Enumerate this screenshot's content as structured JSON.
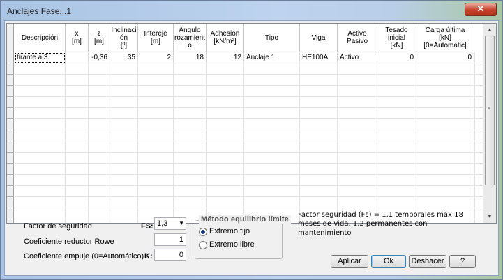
{
  "window": {
    "title": "Anclajes Fase...1",
    "close_label": "✕"
  },
  "grid": {
    "columns": [
      {
        "label": "Descripción"
      },
      {
        "label": "x\n[m]"
      },
      {
        "label": "z\n[m]"
      },
      {
        "label": "Inclinaci\nón\n[º]"
      },
      {
        "label": "Intereje\n[m]"
      },
      {
        "label": "Ángulo\nrozamient\no"
      },
      {
        "label": "Adhesión\n[kN/m²]"
      },
      {
        "label": "Tipo"
      },
      {
        "label": "Viga"
      },
      {
        "label": "Activo\nPasivo"
      },
      {
        "label": "Tesado\ninicial\n[kN]"
      },
      {
        "label": "Carga última\n[kN]\n[0=Automatic]"
      }
    ],
    "rows": [
      [
        "tirante a 3",
        "",
        "-0,36",
        "35",
        "2",
        "18",
        "12",
        "Anclaje 1",
        "HE100A",
        "Activo",
        "0",
        "0"
      ]
    ]
  },
  "form": {
    "fs_label": "Factor de seguridad",
    "fs_short": "FS:",
    "fs_value": "1,3",
    "rowe_label": "Coeficiente reductor Rowe",
    "rowe_value": "1",
    "empuje_label": "Coeficiente empuje (0=Automático)",
    "empuje_short": "K:",
    "empuje_value": "0"
  },
  "metodo": {
    "title": "Método equilibrio límite",
    "options": [
      {
        "label": "Extremo fijo",
        "selected": true
      },
      {
        "label": "Extremo libre",
        "selected": false
      }
    ]
  },
  "note": "Factor seguridad (Fs) = 1.1 temporales máx 18 meses de vida, 1.2 permanentes con mantenimiento",
  "buttons": {
    "apply": "Aplicar",
    "ok": "Ok",
    "undo": "Deshacer",
    "help": "?"
  }
}
